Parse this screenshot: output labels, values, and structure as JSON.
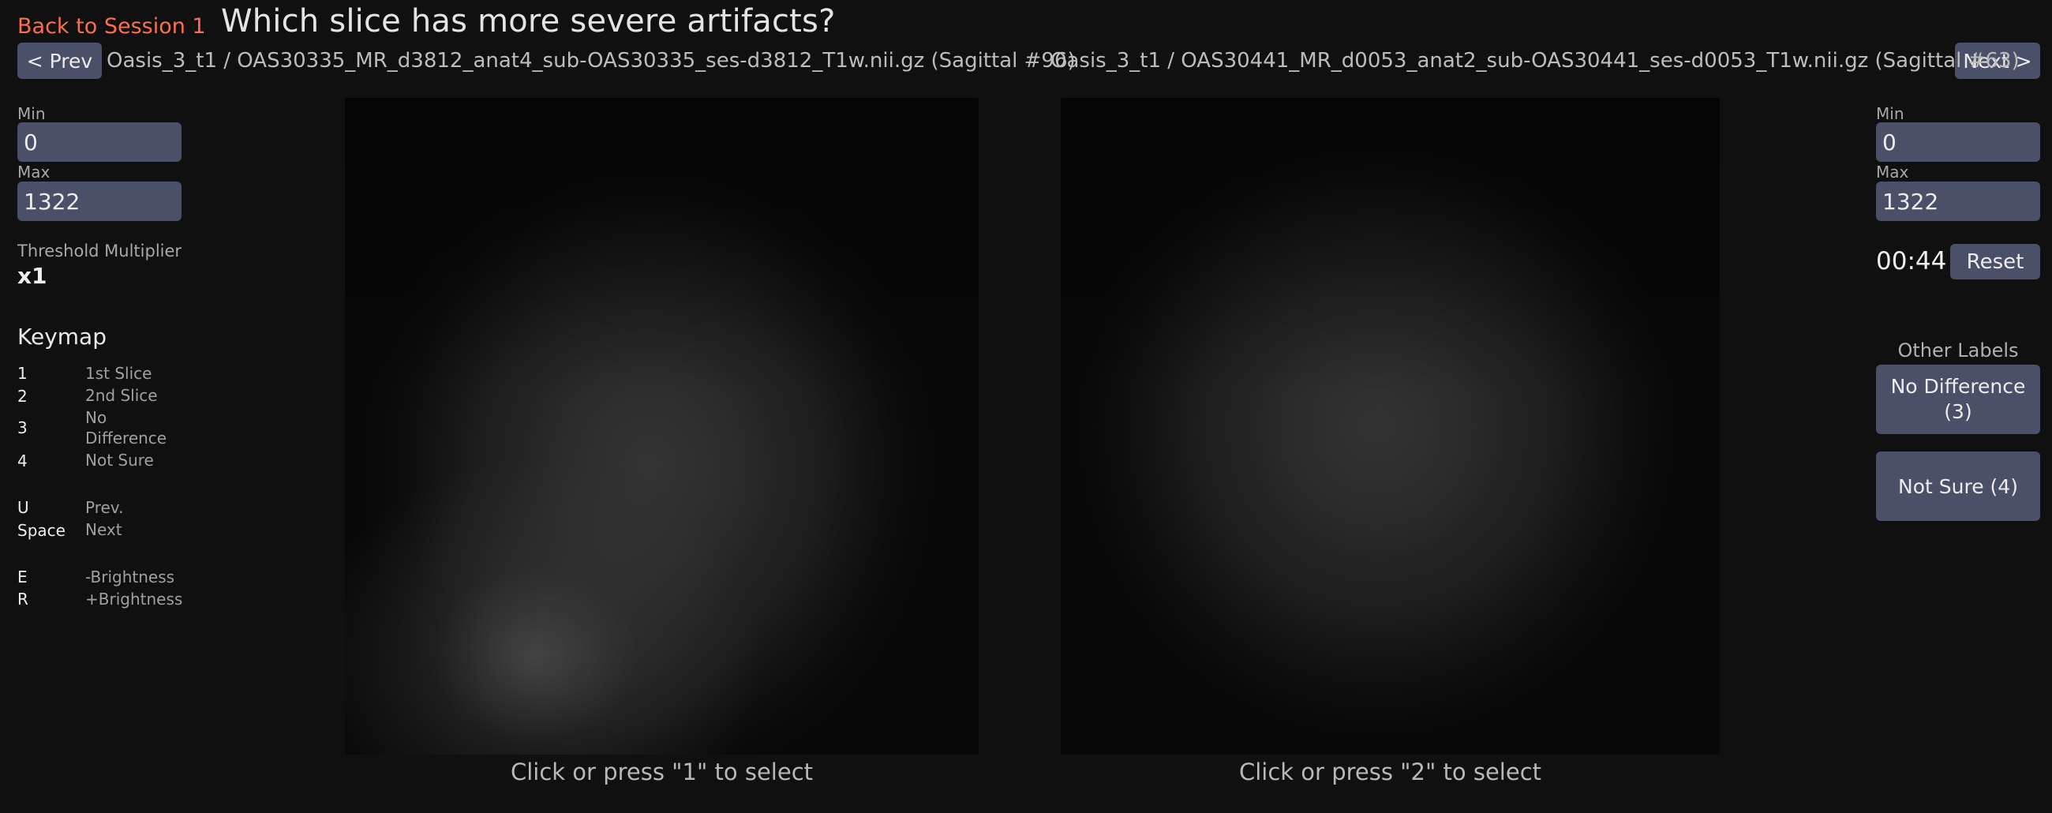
{
  "header": {
    "back_link": "Back to Session 1",
    "title": "Which slice has more severe artifacts?",
    "prev_label": "< Prev",
    "next_label": "Next >"
  },
  "slices": {
    "left": {
      "path": "Oasis_3_t1 / OAS30335_MR_d3812_anat4_sub-OAS30335_ses-d3812_T1w.nii.gz (Sagittal #96)",
      "caption": "Click or press \"1\" to select"
    },
    "right": {
      "path": "Oasis_3_t1 / OAS30441_MR_d0053_anat2_sub-OAS30441_ses-d0053_T1w.nii.gz (Sagittal #63)",
      "caption": "Click or press \"2\" to select"
    }
  },
  "left_panel": {
    "min_label": "Min",
    "min_value": "0",
    "max_label": "Max",
    "max_value": "1322",
    "threshold_label": "Threshold Multiplier",
    "threshold_value": "x1",
    "keymap_title": "Keymap",
    "keymap": [
      {
        "key": "1",
        "action": "1st Slice"
      },
      {
        "key": "2",
        "action": "2nd Slice"
      },
      {
        "key": "3",
        "action": "No Difference"
      },
      {
        "key": "4",
        "action": "Not Sure"
      },
      {
        "key": "U",
        "action": "Prev."
      },
      {
        "key": "Space",
        "action": "Next"
      },
      {
        "key": "E",
        "action": "-Brightness"
      },
      {
        "key": "R",
        "action": "+Brightness"
      }
    ]
  },
  "right_panel": {
    "min_label": "Min",
    "min_value": "0",
    "max_label": "Max",
    "max_value": "1322",
    "timer": "00:44",
    "reset_label": "Reset",
    "other_labels_title": "Other Labels",
    "no_difference_label": "No Difference (3)",
    "not_sure_label": "Not Sure (4)"
  },
  "colors": {
    "background": "#101010",
    "accent_link": "#ff6e4a",
    "button": "#4a5068"
  }
}
